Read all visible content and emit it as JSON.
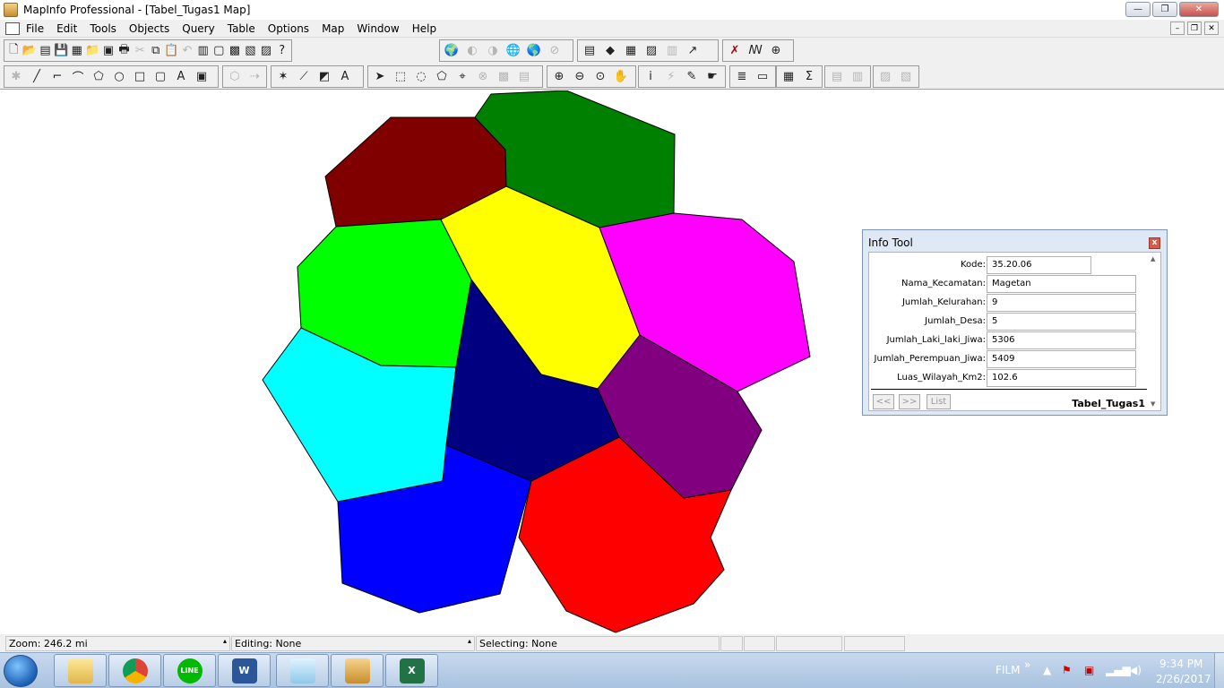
{
  "window": {
    "title": "MapInfo Professional - [Tabel_Tugas1 Map]",
    "minimize_label": "—",
    "restore_label": "❐",
    "close_label": "✕"
  },
  "menu": {
    "items": [
      "File",
      "Edit",
      "Tools",
      "Objects",
      "Query",
      "Table",
      "Options",
      "Map",
      "Window",
      "Help"
    ],
    "doc_minimize": "–",
    "doc_restore": "❐",
    "doc_close": "✕"
  },
  "map": {
    "regions": [
      {
        "name": "maroon-region",
        "color": "#800000"
      },
      {
        "name": "green-region",
        "color": "#008000"
      },
      {
        "name": "lime-region",
        "color": "#00ff00"
      },
      {
        "name": "yellow-region",
        "color": "#ffff00"
      },
      {
        "name": "magenta-region",
        "color": "#ff00ff"
      },
      {
        "name": "cyan-region",
        "color": "#00ffff"
      },
      {
        "name": "navy-region",
        "color": "#000080"
      },
      {
        "name": "purple-region",
        "color": "#800080"
      },
      {
        "name": "blue-region",
        "color": "#0000ff"
      },
      {
        "name": "red-region",
        "color": "#ff0000"
      }
    ]
  },
  "info_tool": {
    "title": "Info Tool",
    "close_label": "x",
    "fields": [
      {
        "label": "Kode:",
        "value": "35.20.06"
      },
      {
        "label": "Nama_Kecamatan:",
        "value": "Magetan"
      },
      {
        "label": "Jumlah_Kelurahan:",
        "value": "9"
      },
      {
        "label": "Jumlah_Desa:",
        "value": "5"
      },
      {
        "label": "Jumlah_Laki_laki_Jiwa:",
        "value": "5306"
      },
      {
        "label": "Jumlah_Perempuan_Jiwa:",
        "value": "5409"
      },
      {
        "label": "Luas_Wilayah_Km2:",
        "value": "102.6"
      }
    ],
    "prev_label": "<<",
    "next_label": ">>",
    "list_label": "List",
    "table_name": "Tabel_Tugas1"
  },
  "status": {
    "zoom": "Zoom: 246.2 mi",
    "editing": "Editing: None",
    "selecting": "Selecting: None"
  },
  "taskbar": {
    "apps": [
      "file-explorer",
      "chrome",
      "line",
      "word",
      "notepad",
      "mapinfo",
      "excel"
    ],
    "tray_label": "FILM",
    "time": "9:34 PM",
    "date": "2/26/2017"
  }
}
